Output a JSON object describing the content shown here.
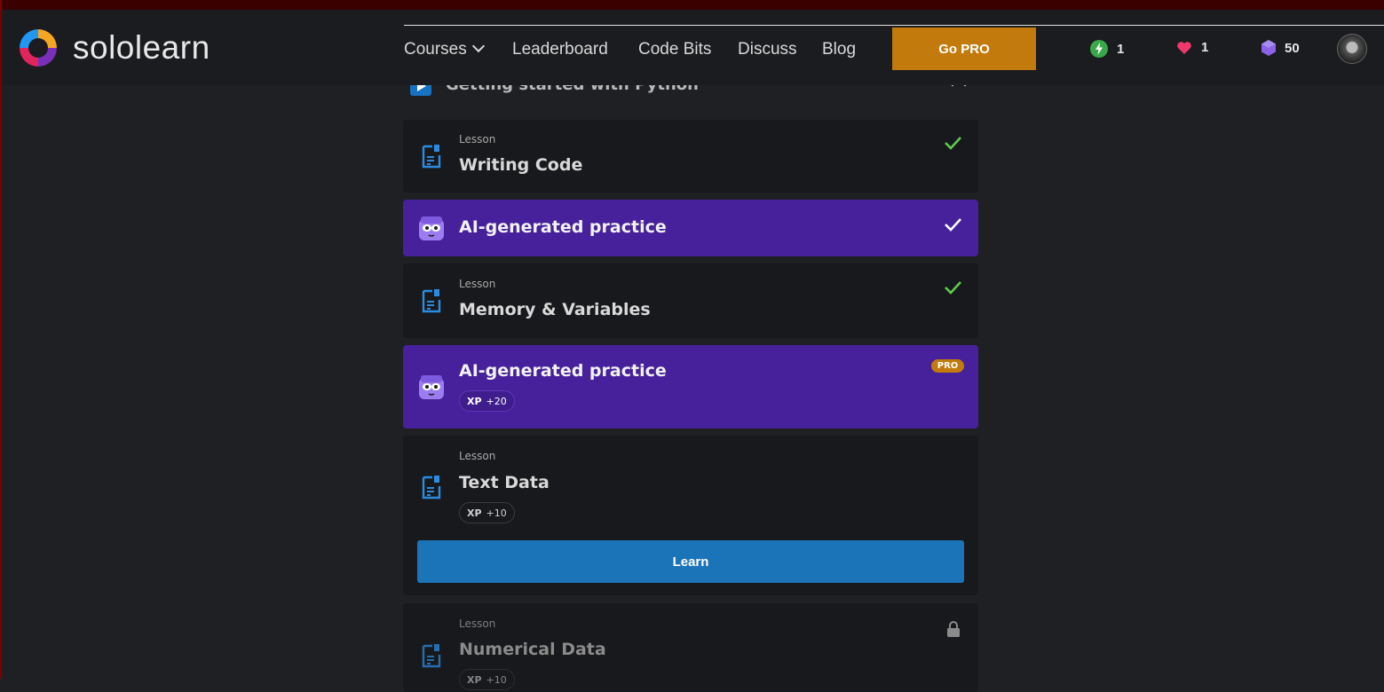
{
  "brand": {
    "name": "sololearn"
  },
  "nav": {
    "courses": "Courses",
    "leaderboard": "Leaderboard",
    "code_bits": "Code Bits",
    "discuss": "Discuss",
    "blog": "Blog",
    "go_pro": "Go PRO"
  },
  "stats": {
    "streak": "1",
    "hearts": "1",
    "gems": "50"
  },
  "section": {
    "title": "Getting started with Python"
  },
  "cards": [
    {
      "type": "Lesson",
      "title": "Writing Code",
      "status": "completed"
    },
    {
      "title": "AI-generated practice",
      "status": "completed"
    },
    {
      "type": "Lesson",
      "title": "Memory & Variables",
      "status": "completed"
    },
    {
      "title": "AI-generated practice",
      "badge": "PRO",
      "xp_label": "XP",
      "xp_value": "+20"
    },
    {
      "type": "Lesson",
      "title": "Text Data",
      "xp_label": "XP",
      "xp_value": "+10",
      "button": "Learn"
    },
    {
      "type": "Lesson",
      "title": "Numerical Data",
      "status": "locked",
      "xp_label": "XP",
      "xp_value": "+10"
    }
  ],
  "colors": {
    "accent": "#c27a0c",
    "ai_card": "#47219b",
    "learn_button": "#1c74b8",
    "check_green": "#5ecb4e"
  }
}
